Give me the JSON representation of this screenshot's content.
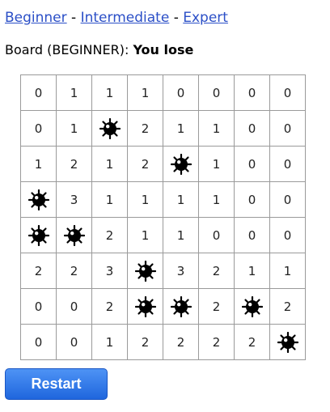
{
  "nav": {
    "links": [
      "Beginner",
      "Intermediate",
      "Expert"
    ],
    "separator": "-"
  },
  "status": {
    "prefix": "Board (BEGINNER): ",
    "result": "You lose"
  },
  "board": [
    [
      "0",
      "1",
      "1",
      "1",
      "0",
      "0",
      "0",
      "0"
    ],
    [
      "0",
      "1",
      "mine",
      "2",
      "1",
      "1",
      "0",
      "0"
    ],
    [
      "1",
      "2",
      "1",
      "2",
      "mine",
      "1",
      "0",
      "0"
    ],
    [
      "mine",
      "3",
      "1",
      "1",
      "1",
      "1",
      "0",
      "0"
    ],
    [
      "mine",
      "mine",
      "2",
      "1",
      "1",
      "0",
      "0",
      "0"
    ],
    [
      "2",
      "2",
      "3",
      "mine",
      "3",
      "2",
      "1",
      "1"
    ],
    [
      "0",
      "0",
      "2",
      "mine",
      "mine",
      "2",
      "mine",
      "2"
    ],
    [
      "0",
      "0",
      "1",
      "2",
      "2",
      "2",
      "2",
      "mine"
    ]
  ],
  "restart_label": "Restart",
  "colors": {
    "link": "#2b4fc7",
    "button": "#2f74e8",
    "cell_border": "#9a9a9a"
  },
  "icons": {
    "mine": "mine-icon"
  }
}
